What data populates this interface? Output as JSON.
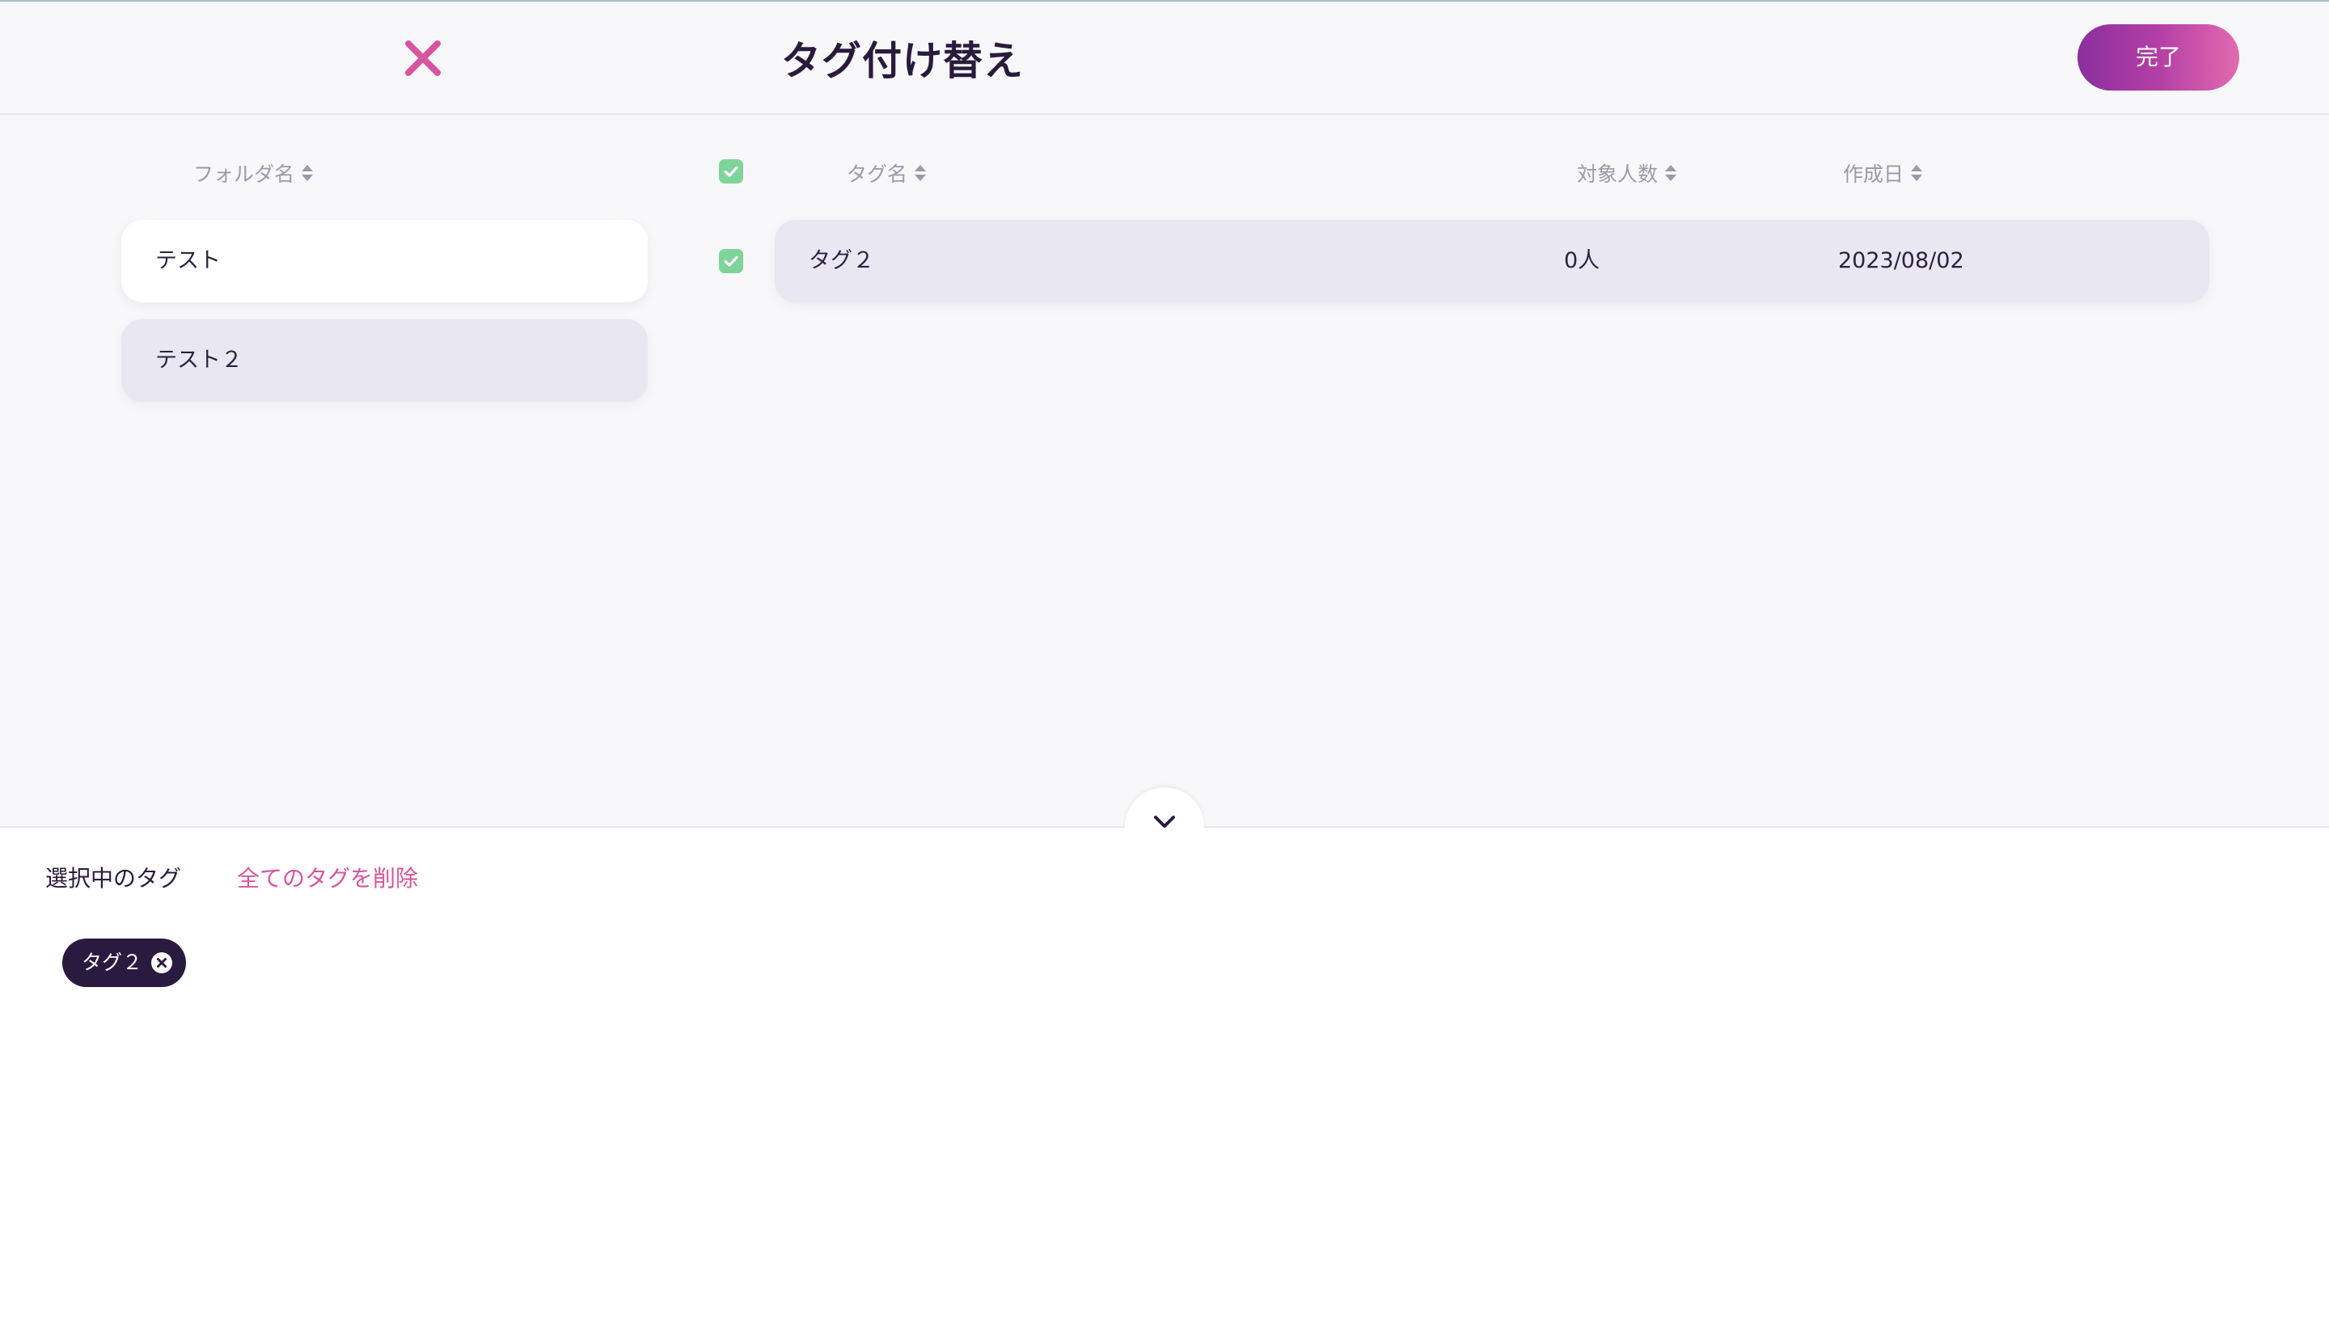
{
  "header": {
    "title": "タグ付け替え",
    "done_label": "完了",
    "close_icon": "close-icon"
  },
  "colors": {
    "accent_pink": "#d6559e",
    "done_gradient_start": "#8b2f9e",
    "done_gradient_end": "#e26ab0",
    "checkbox_green": "#7fd49a",
    "chip_bg": "#2b1a40"
  },
  "folders": {
    "column_header": "フォルダ名",
    "items": [
      {
        "label": "テスト",
        "selected": true
      },
      {
        "label": "テスト２",
        "selected": false
      }
    ]
  },
  "tags": {
    "select_all_checked": true,
    "columns": {
      "name": "タグ名",
      "count": "対象人数",
      "created": "作成日"
    },
    "rows": [
      {
        "checked": true,
        "name": "タグ２",
        "count": "0人",
        "created": "2023/08/02"
      }
    ]
  },
  "selection": {
    "label": "選択中のタグ",
    "delete_all_label": "全てのタグを削除",
    "chips": [
      {
        "label": "タグ２"
      }
    ]
  }
}
